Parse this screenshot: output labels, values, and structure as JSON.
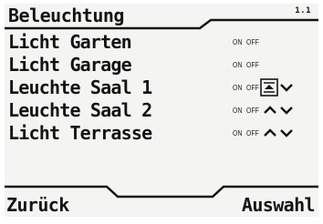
{
  "header": {
    "title": "Beleuchtung",
    "page": "1.1"
  },
  "list": {
    "on_label": "ON",
    "off_label": "OFF",
    "items": [
      {
        "label": "Licht Garten",
        "controls": "none"
      },
      {
        "label": "Licht Garage",
        "controls": "none"
      },
      {
        "label": "Leuchte Saal 1",
        "controls": "up-down",
        "selected_control": "up"
      },
      {
        "label": "Leuchte Saal 2",
        "controls": "up-down"
      },
      {
        "label": "Licht Terrasse",
        "controls": "up-down"
      }
    ]
  },
  "softkeys": {
    "left": "Zurück",
    "right": "Auswahl"
  },
  "icons": [
    "arrow-up-icon",
    "arrow-down-icon",
    "selected-arrow-up-icon"
  ]
}
